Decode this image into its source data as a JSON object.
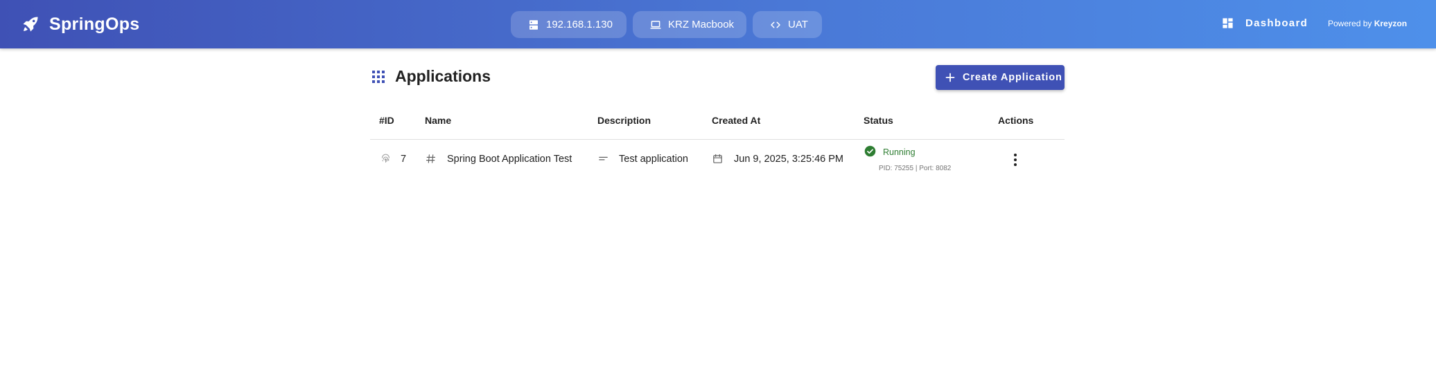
{
  "app": {
    "title": "SpringOps"
  },
  "header": {
    "chips": [
      {
        "label": "192.168.1.130",
        "icon": "server-icon"
      },
      {
        "label": "KRZ Macbook",
        "icon": "laptop-icon"
      },
      {
        "label": "UAT",
        "icon": "code-icon"
      }
    ],
    "dashboard_label": "Dashboard",
    "powered_by_prefix": "Powered by",
    "powered_by_brand": "Kreyzon"
  },
  "page": {
    "title": "Applications",
    "create_button_label": "Create Application"
  },
  "table": {
    "columns": [
      "#ID",
      "Name",
      "Description",
      "Created At",
      "Status",
      "Actions"
    ],
    "rows": [
      {
        "id": "7",
        "name": "Spring Boot Application Test",
        "description": "Test application",
        "created_at": "Jun 9, 2025, 3:25:46 PM",
        "status": "Running",
        "status_meta": "PID: 75255 | Port: 8082"
      }
    ]
  },
  "colors": {
    "primary": "#3f51b5",
    "header_gradient_start": "#3f51b5",
    "header_gradient_end": "#4e90ea",
    "status_running": "#2e7d32"
  }
}
